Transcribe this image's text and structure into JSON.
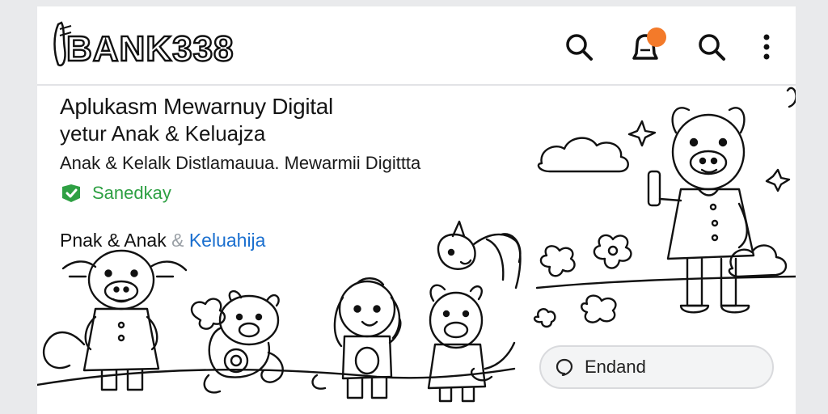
{
  "app": {
    "brand": "BANK338"
  },
  "toolbar": {
    "icons": [
      "search-icon",
      "notification-bell-icon",
      "search-icon",
      "more-vertical-icon"
    ],
    "notification_dot_color": "#f37a2a"
  },
  "hero": {
    "title_line1": "Aplukasm Mewarnuy Digital",
    "title_line2": "yetur Anak & Keluajza",
    "subtitle": "Anak & Kelalk Distlamauua. Mewarmii Digittta",
    "rating_label": "Sanedkay"
  },
  "category": {
    "part1": "Pnak & Anak",
    "amp": " & ",
    "part2": "Keluahija"
  },
  "cta": {
    "label": "Endand"
  },
  "colors": {
    "accent_green": "#2ea043",
    "link_blue": "#1a6fcf",
    "notification_orange": "#f37a2a"
  }
}
